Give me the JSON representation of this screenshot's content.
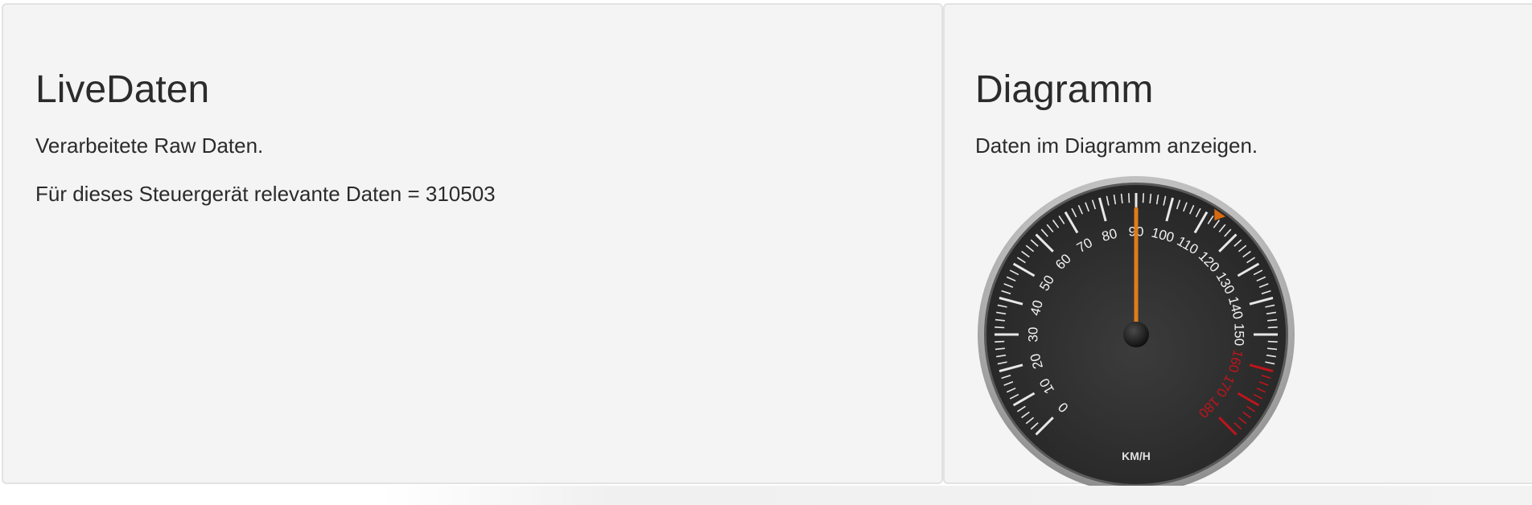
{
  "live": {
    "title": "LiveDaten",
    "description": "Verarbeitete Raw Daten.",
    "relevant_text": "Für dieses Steuergerät relevante Daten = 310503"
  },
  "diagram": {
    "title": "Diagramm",
    "description": "Daten im Diagramm anzeigen."
  },
  "gauge": {
    "unit": "KM/H",
    "min": 0,
    "max": 180,
    "major_step": 10,
    "labels": [
      "0",
      "10",
      "20",
      "30",
      "40",
      "50",
      "60",
      "70",
      "80",
      "90",
      "100",
      "110",
      "120",
      "130",
      "140",
      "150",
      "160",
      "170",
      "180"
    ],
    "value": 90,
    "marker_value": 113,
    "red_zone_start": 160,
    "colors": {
      "face": "#2f2f2f",
      "tick": "#e8e8e8",
      "red_zone": "#c0141b",
      "needle": "#e07b1a",
      "marker": "#d86a12"
    }
  }
}
